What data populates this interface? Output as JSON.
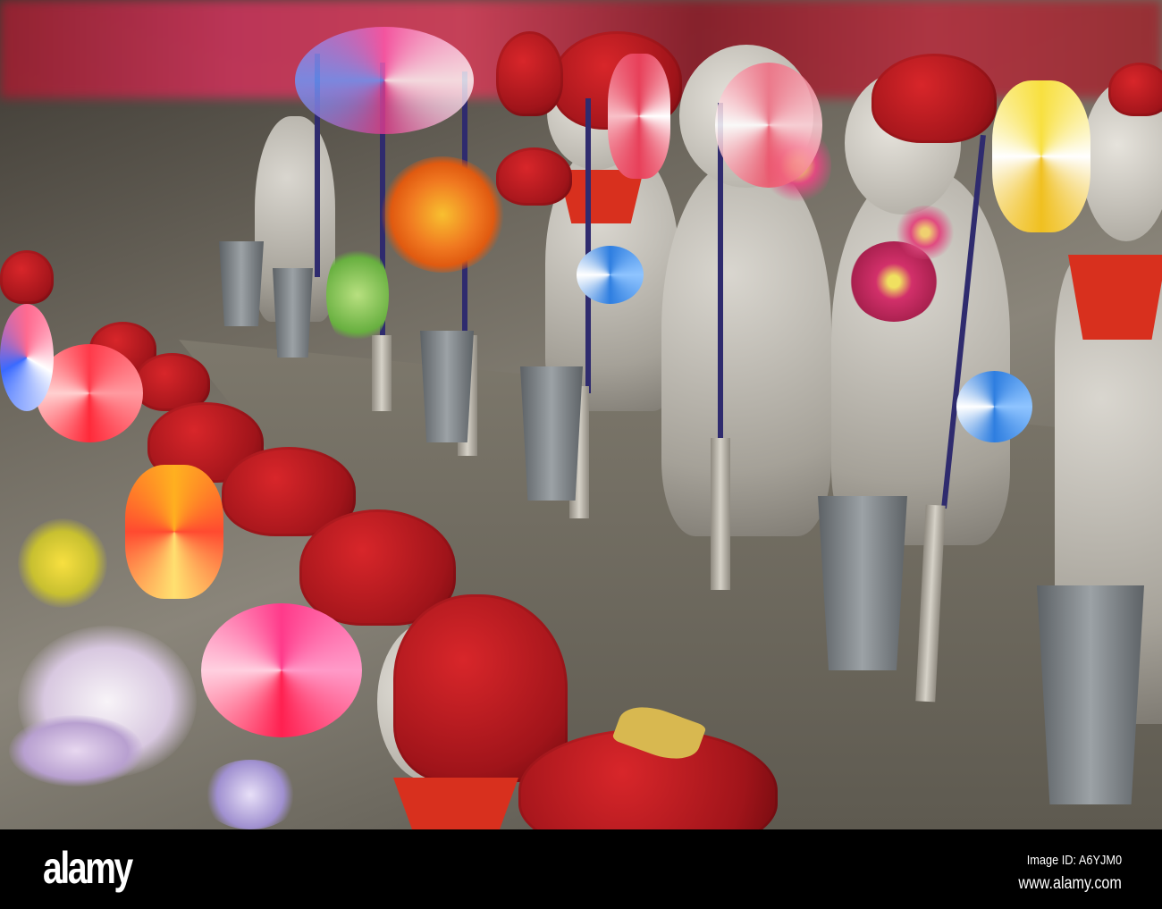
{
  "photo": {
    "subject": "jizo-statues",
    "colors": {
      "knit_red": "#b0161c",
      "stone": "#a9a59c",
      "bib": "#d8301e"
    }
  },
  "footer": {
    "logo": "alamy",
    "image_id": "Image ID: A6YJM0",
    "website": "www.alamy.com"
  }
}
